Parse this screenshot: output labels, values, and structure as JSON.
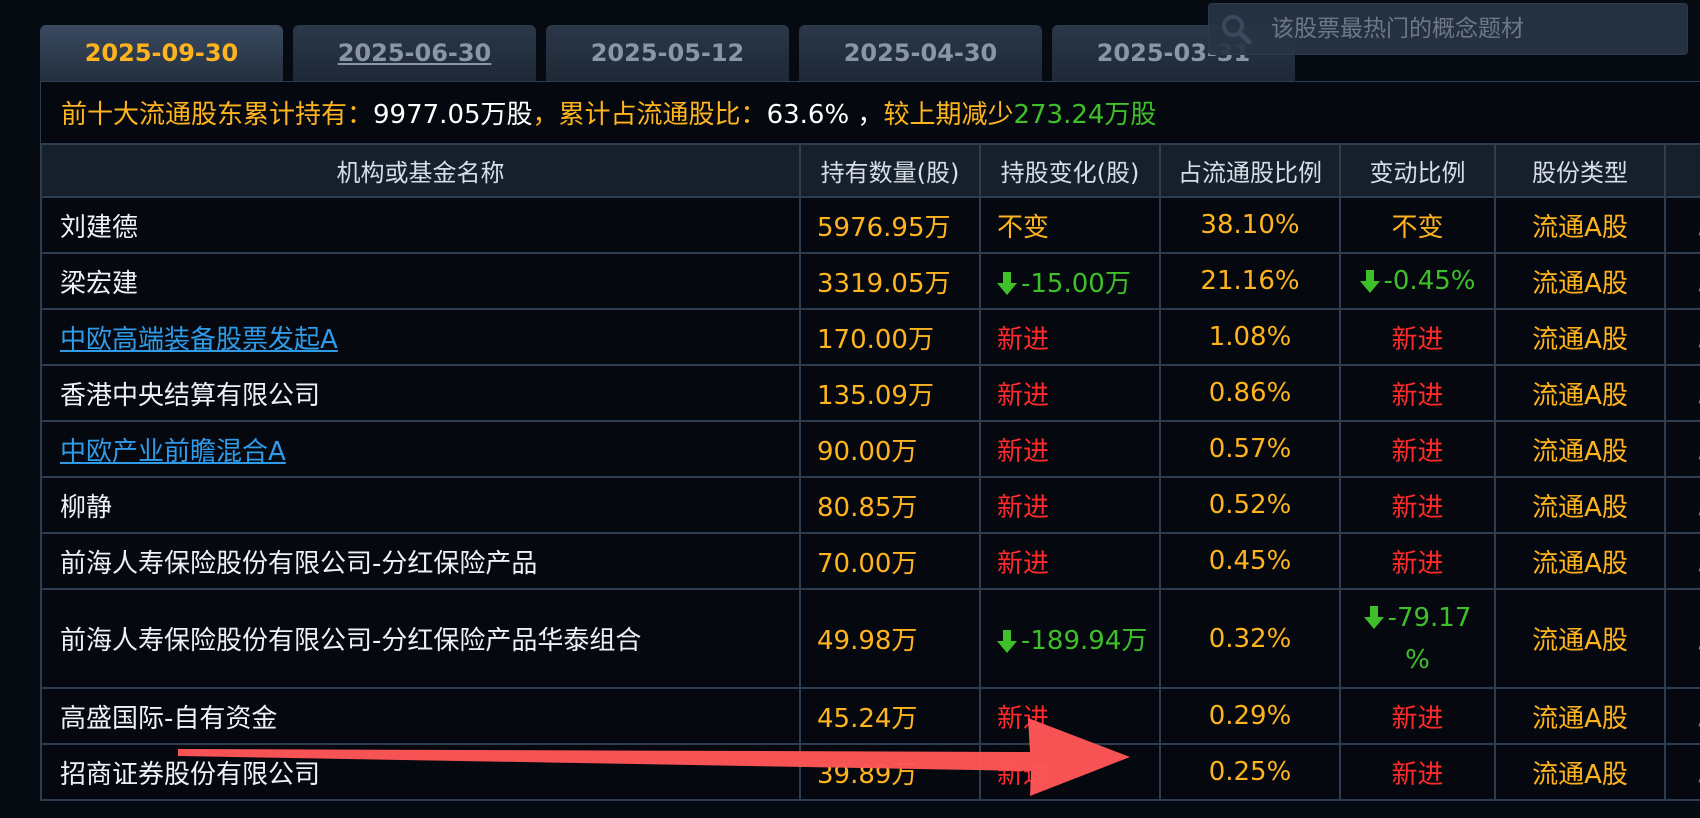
{
  "tabs": [
    {
      "label": "2025-09-30",
      "active": true
    },
    {
      "label": "2025-06-30",
      "active": false
    },
    {
      "label": "2025-05-12",
      "active": false
    },
    {
      "label": "2025-04-30",
      "active": false
    },
    {
      "label": "2025-03-31",
      "active": false
    }
  ],
  "search": {
    "placeholder": "该股票最热门的概念题材",
    "icon": "search-icon"
  },
  "summary": {
    "label1": "前十大流通股东累计持有：",
    "value1": "9977.05万股",
    "label2": "，累计占流通股比：",
    "value2": "63.6% ，",
    "label3": " 较上期减少",
    "value3": "273.24万股"
  },
  "table": {
    "headers": [
      "机构或基金名称",
      "持有数量(股)",
      "持股变化(股)",
      "占流通股比例",
      "变动比例",
      "股份类型"
    ],
    "rows": [
      {
        "name": "刘建德",
        "link": false,
        "qty": "5976.95万",
        "change": "不变",
        "change_type": "same",
        "ratio": "38.10%",
        "delta": "不变",
        "delta_type": "same",
        "stype": "流通A股"
      },
      {
        "name": "梁宏建",
        "link": false,
        "qty": "3319.05万",
        "change": "-15.00万",
        "change_type": "down",
        "ratio": "21.16%",
        "delta": "-0.45%",
        "delta_type": "down",
        "stype": "流通A股"
      },
      {
        "name": "中欧高端装备股票发起A",
        "link": true,
        "qty": "170.00万",
        "change": "新进",
        "change_type": "new",
        "ratio": "1.08%",
        "delta": "新进",
        "delta_type": "new",
        "stype": "流通A股"
      },
      {
        "name": "香港中央结算有限公司",
        "link": false,
        "qty": "135.09万",
        "change": "新进",
        "change_type": "new",
        "ratio": "0.86%",
        "delta": "新进",
        "delta_type": "new",
        "stype": "流通A股"
      },
      {
        "name": "中欧产业前瞻混合A",
        "link": true,
        "qty": "90.00万",
        "change": "新进",
        "change_type": "new",
        "ratio": "0.57%",
        "delta": "新进",
        "delta_type": "new",
        "stype": "流通A股"
      },
      {
        "name": "柳静",
        "link": false,
        "qty": "80.85万",
        "change": "新进",
        "change_type": "new",
        "ratio": "0.52%",
        "delta": "新进",
        "delta_type": "new",
        "stype": "流通A股"
      },
      {
        "name": "前海人寿保险股份有限公司-分红保险产品",
        "link": false,
        "qty": "70.00万",
        "change": "新进",
        "change_type": "new",
        "ratio": "0.45%",
        "delta": "新进",
        "delta_type": "new",
        "stype": "流通A股"
      },
      {
        "name": "前海人寿保险股份有限公司-分红保险产品华泰组合",
        "link": false,
        "qty": "49.98万",
        "change": "-189.94万",
        "change_type": "down",
        "ratio": "0.32%",
        "delta": "-79.17",
        "delta2": "%",
        "delta_type": "down",
        "stype": "流通A股",
        "tall": true
      },
      {
        "name": "高盛国际-自有资金",
        "link": false,
        "qty": "45.24万",
        "change": "新进",
        "change_type": "new",
        "ratio": "0.29%",
        "delta": "新进",
        "delta_type": "new",
        "stype": "流通A股"
      },
      {
        "name": "招商证券股份有限公司",
        "link": false,
        "qty": "39.89万",
        "change": "新进",
        "change_type": "new",
        "ratio": "0.25%",
        "delta": "新进",
        "delta_type": "new",
        "stype": "流通A股"
      }
    ]
  },
  "colors": {
    "amber": "#ffb41f",
    "red": "#ff2a2a",
    "green": "#3fbf2a",
    "link": "#2f9be8",
    "arrow": "#ff4d4f"
  }
}
